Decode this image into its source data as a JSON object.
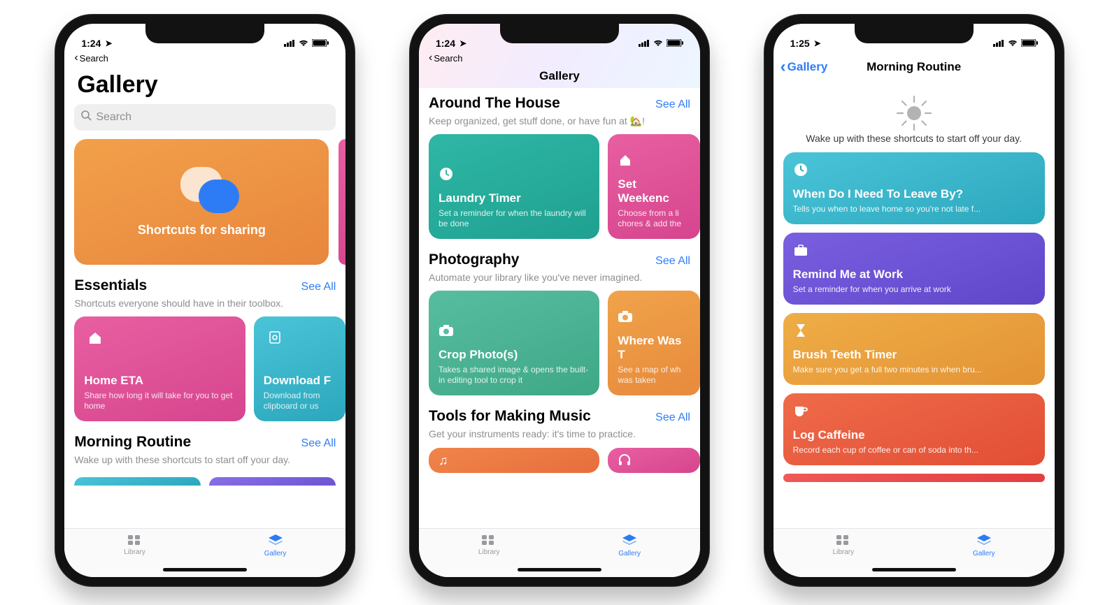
{
  "status": {
    "time1": "1:24",
    "time2": "1:24",
    "time3": "1:25",
    "back_search": "Search"
  },
  "screen1": {
    "title": "Gallery",
    "search_placeholder": "Search",
    "hero_title": "Shortcuts for sharing",
    "see_all": "See All",
    "essentials": {
      "title": "Essentials",
      "sub": "Shortcuts everyone should have in their toolbox.",
      "cards": [
        {
          "title": "Home ETA",
          "desc": "Share how long it will take for you to get home"
        },
        {
          "title": "Download F",
          "desc": "Download from clipboard or us"
        }
      ]
    },
    "morning": {
      "title": "Morning Routine",
      "sub": "Wake up with these shortcuts to start off your day."
    }
  },
  "screen2": {
    "nav_title": "Gallery",
    "see_all": "See All",
    "house": {
      "title": "Around The House",
      "sub": "Keep organized, get stuff done, or have fun at 🏡!",
      "cards": [
        {
          "title": "Laundry Timer",
          "desc": "Set a reminder for when the laundry will be done"
        },
        {
          "title": "Set Weekenc",
          "desc": "Choose from a li chores & add the"
        }
      ]
    },
    "photo": {
      "title": "Photography",
      "sub": "Automate your library like you've never imagined.",
      "cards": [
        {
          "title": "Crop Photo(s)",
          "desc": "Takes a shared image & opens the built-in editing tool to crop it"
        },
        {
          "title": "Where Was T",
          "desc": "See a map of wh was taken"
        }
      ]
    },
    "music": {
      "title": "Tools for Making Music",
      "sub": "Get your instruments ready: it's time to practice."
    }
  },
  "screen3": {
    "back": "Gallery",
    "nav_title": "Morning Routine",
    "intro": "Wake up with these shortcuts to start off your day.",
    "cards": [
      {
        "title": "When Do I Need To Leave By?",
        "desc": "Tells you when to leave home so you're not late f..."
      },
      {
        "title": "Remind Me at Work",
        "desc": "Set a reminder for when you arrive at work"
      },
      {
        "title": "Brush Teeth Timer",
        "desc": "Make sure you get a full two minutes in when bru..."
      },
      {
        "title": "Log Caffeine",
        "desc": "Record each cup of coffee or can of soda into th..."
      }
    ]
  },
  "tabs": {
    "library": "Library",
    "gallery": "Gallery"
  },
  "colors": {
    "pink": "linear-gradient(160deg,#e85fa1,#d6458e)",
    "teal": "linear-gradient(160deg,#43c1cd,#2aa7b4)",
    "teal2": "linear-gradient(160deg,#58bda0,#3ea886)",
    "orange": "linear-gradient(160deg,#f0a34a,#e78a3c)",
    "blue": "linear-gradient(160deg,#4bc4d8,#2ba7bd)",
    "purple": "linear-gradient(160deg,#7a5fe0,#5f46c9)",
    "amber": "linear-gradient(160deg,#efad46,#e39335)",
    "red": "linear-gradient(160deg,#ef6b4a,#e24e34)"
  }
}
